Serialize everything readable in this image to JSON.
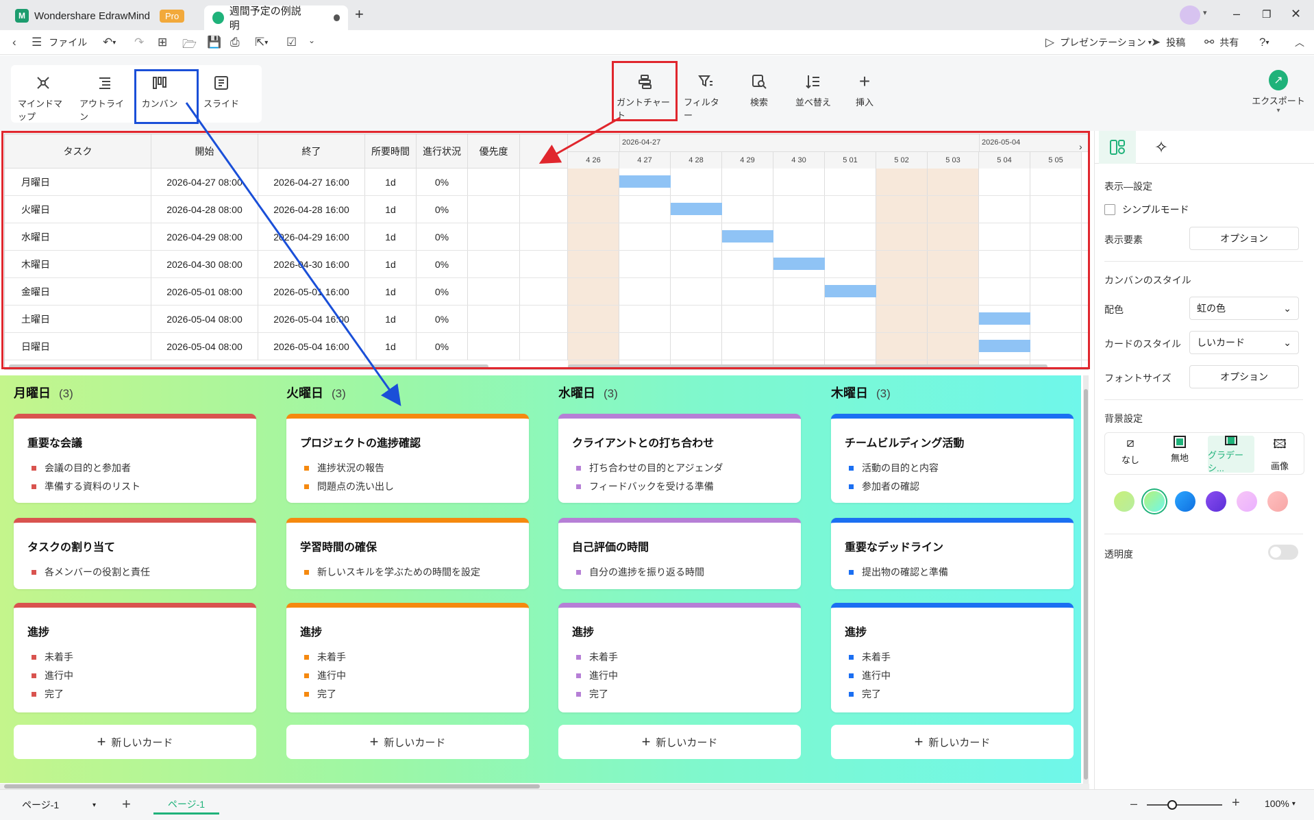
{
  "window": {
    "app_name": "Wondershare EdrawMind",
    "pro_badge": "Pro",
    "doc_tab": "週間予定の例説明"
  },
  "menubar": {
    "file": "ファイル",
    "presentation": "プレゼンテーション",
    "post": "投稿",
    "share": "共有"
  },
  "views": {
    "mindmap": "マインドマップ",
    "outline": "アウトライン",
    "kanban": "カンバン",
    "slide": "スライド"
  },
  "tools": {
    "gantt": "ガントチャート",
    "filter": "フィルター",
    "search": "検索",
    "sort": "並べ替え",
    "insert": "挿入",
    "export": "エクスポート"
  },
  "gantt": {
    "headers": [
      "タスク",
      "開始",
      "終了",
      "所要時間",
      "進行状況",
      "優先度"
    ],
    "week1": "2026-04-27",
    "week2": "2026-05-04",
    "days": [
      "4 26",
      "4 27",
      "4 28",
      "4 29",
      "4 30",
      "5 01",
      "5 02",
      "5 03",
      "5 04",
      "5 05"
    ],
    "rows": [
      {
        "task": "月曜日",
        "start": "2026-04-27 08:00",
        "end": "2026-04-27 16:00",
        "dur": "1d",
        "prog": "0%"
      },
      {
        "task": "火曜日",
        "start": "2026-04-28 08:00",
        "end": "2026-04-28 16:00",
        "dur": "1d",
        "prog": "0%"
      },
      {
        "task": "水曜日",
        "start": "2026-04-29 08:00",
        "end": "2026-04-29 16:00",
        "dur": "1d",
        "prog": "0%"
      },
      {
        "task": "木曜日",
        "start": "2026-04-30 08:00",
        "end": "2026-04-30 16:00",
        "dur": "1d",
        "prog": "0%"
      },
      {
        "task": "金曜日",
        "start": "2026-05-01 08:00",
        "end": "2026-05-01 16:00",
        "dur": "1d",
        "prog": "0%"
      },
      {
        "task": "土曜日",
        "start": "2026-05-04 08:00",
        "end": "2026-05-04 16:00",
        "dur": "1d",
        "prog": "0%"
      },
      {
        "task": "日曜日",
        "start": "2026-05-04 08:00",
        "end": "2026-05-04 16:00",
        "dur": "1d",
        "prog": "0%"
      }
    ]
  },
  "kanban": {
    "new_card": "新しいカード",
    "columns": [
      {
        "title": "月曜日",
        "count": "(3)",
        "color": "#d9534f",
        "cards": [
          {
            "title": "重要な会議",
            "items": [
              "会議の目的と参加者",
              "準備する資料のリスト"
            ]
          },
          {
            "title": "タスクの割り当て",
            "items": [
              "各メンバーの役割と責任"
            ]
          },
          {
            "title": "進捗",
            "items": [
              "未着手",
              "進行中",
              "完了"
            ]
          }
        ]
      },
      {
        "title": "火曜日",
        "count": "(3)",
        "color": "#f5890f",
        "cards": [
          {
            "title": "プロジェクトの進捗確認",
            "items": [
              "進捗状況の報告",
              "問題点の洗い出し"
            ]
          },
          {
            "title": "学習時間の確保",
            "items": [
              "新しいスキルを学ぶための時間を設定"
            ]
          },
          {
            "title": "進捗",
            "items": [
              "未着手",
              "進行中",
              "完了"
            ]
          }
        ]
      },
      {
        "title": "水曜日",
        "count": "(3)",
        "color": "#b67fd6",
        "cards": [
          {
            "title": "クライアントとの打ち合わせ",
            "items": [
              "打ち合わせの目的とアジェンダ",
              "フィードバックを受ける準備"
            ]
          },
          {
            "title": "自己評価の時間",
            "items": [
              "自分の進捗を振り返る時間"
            ]
          },
          {
            "title": "進捗",
            "items": [
              "未着手",
              "進行中",
              "完了"
            ]
          }
        ]
      },
      {
        "title": "木曜日",
        "count": "(3)",
        "color": "#1b6ff2",
        "cards": [
          {
            "title": "チームビルディング活動",
            "items": [
              "活動の目的と内容",
              "参加者の確認"
            ]
          },
          {
            "title": "重要なデッドライン",
            "items": [
              "提出物の確認と準備"
            ]
          },
          {
            "title": "進捗",
            "items": [
              "未着手",
              "進行中",
              "完了"
            ]
          }
        ]
      }
    ]
  },
  "panel": {
    "display_settings": "表示—設定",
    "simple_mode": "シンプルモード",
    "display_elements": "表示要素",
    "option": "オプション",
    "kanban_style": "カンバンのスタイル",
    "color_scheme": "配色",
    "color_scheme_value": "虹の色",
    "card_style": "カードのスタイル",
    "card_style_value": "しいカード",
    "font_size": "フォントサイズ",
    "bg_settings": "背景設定",
    "bg_none": "なし",
    "bg_plain": "無地",
    "bg_gradient": "グラデーシ...",
    "bg_image": "画像",
    "transparency": "透明度"
  },
  "statusbar": {
    "page_select": "ページ-1",
    "page_tab": "ページ-1",
    "zoom": "100%"
  }
}
